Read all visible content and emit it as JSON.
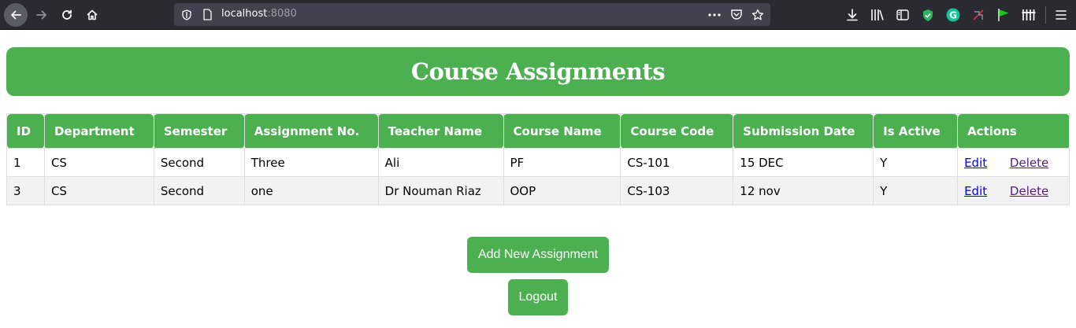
{
  "browser": {
    "url_host": "localhost",
    "url_port": ":8080"
  },
  "page": {
    "title": "Course Assignments",
    "columns": [
      "ID",
      "Department",
      "Semester",
      "Assignment No.",
      "Teacher Name",
      "Course Name",
      "Course Code",
      "Submission Date",
      "Is Active",
      "Actions"
    ],
    "rows": [
      {
        "id": "1",
        "department": "CS",
        "semester": "Second",
        "assignment_no": "Three",
        "teacher": "Ali",
        "course_name": "PF",
        "course_code": "CS-101",
        "submission_date": "15 DEC",
        "is_active": "Y"
      },
      {
        "id": "3",
        "department": "CS",
        "semester": "Second",
        "assignment_no": "one",
        "teacher": "Dr Nouman Riaz",
        "course_name": "OOP",
        "course_code": "CS-103",
        "submission_date": "12 nov",
        "is_active": "Y"
      }
    ],
    "edit_label": "Edit",
    "delete_label": "Delete",
    "add_button": "Add New Assignment",
    "logout_button": "Logout"
  },
  "colors": {
    "accent": "#4caf50",
    "visited_link": "#551a8b",
    "link": "#0000ee"
  },
  "icons": [
    "back-arrow-icon",
    "forward-arrow-icon",
    "reload-icon",
    "home-icon",
    "shield-icon",
    "page-icon",
    "more-icon",
    "pocket-icon",
    "star-icon",
    "download-icon",
    "library-icon",
    "sidebar-icon",
    "extension-shield-icon",
    "grammarly-icon",
    "extension-blocked-icon",
    "flag-icon",
    "extension-grid-icon",
    "menu-icon"
  ]
}
